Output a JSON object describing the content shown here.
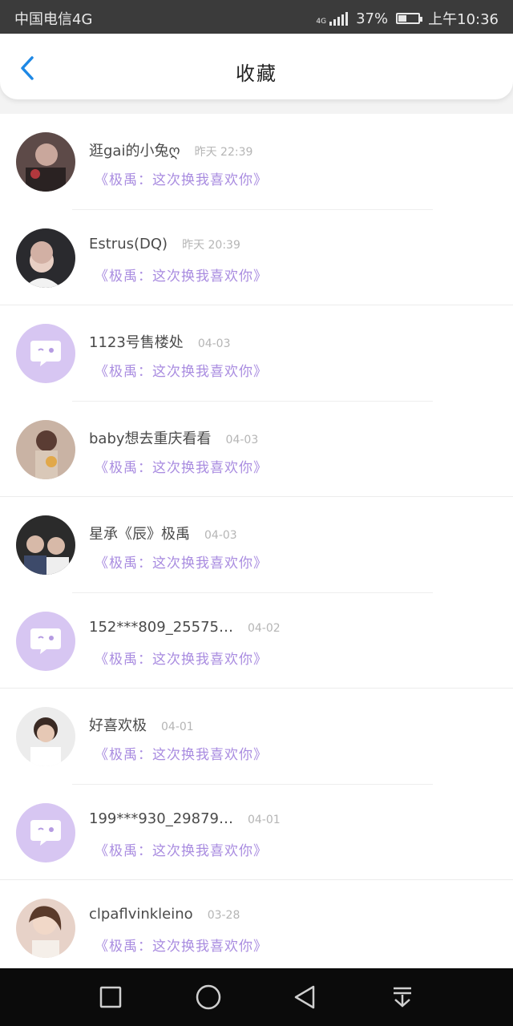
{
  "status_bar": {
    "carrier": "中国电信4G",
    "network": "4G",
    "battery": "37%",
    "battery_level": 0.37,
    "time": "上午10:36"
  },
  "header": {
    "title": "收藏",
    "back_icon": "chevron-left-icon",
    "accent_color": "#1e88e5"
  },
  "colors": {
    "message_color": "#a98ce0",
    "placeholder_avatar": "#d7c6f2"
  },
  "items": [
    {
      "name": "逛gai的小兔ღ",
      "time": "昨天 22:39",
      "message": "《极禹：这次换我喜欢你》",
      "avatar": "photo"
    },
    {
      "name": "Estrus(DQ)",
      "time": "昨天 20:39",
      "message": "《极禹：这次换我喜欢你》",
      "avatar": "photo"
    },
    {
      "name": "1123号售楼处",
      "time": "04-03",
      "message": "《极禹：这次换我喜欢你》",
      "avatar": "placeholder"
    },
    {
      "name": "baby想去重庆看看",
      "time": "04-03",
      "message": "《极禹：这次换我喜欢你》",
      "avatar": "photo"
    },
    {
      "name": "星承《辰》极禹",
      "time": "04-03",
      "message": "《极禹：这次换我喜欢你》",
      "avatar": "photo"
    },
    {
      "name": "152***809_25575…",
      "time": "04-02",
      "message": "《极禹：这次换我喜欢你》",
      "avatar": "placeholder"
    },
    {
      "name": "好喜欢极",
      "time": "04-01",
      "message": "《极禹：这次换我喜欢你》",
      "avatar": "photo"
    },
    {
      "name": "199***930_29879…",
      "time": "04-01",
      "message": "《极禹：这次换我喜欢你》",
      "avatar": "placeholder"
    },
    {
      "name": "clpaflvinkleino",
      "time": "03-28",
      "message": "《极禹：这次换我喜欢你》",
      "avatar": "photo"
    }
  ],
  "nav": {
    "recent_icon": "square-icon",
    "home_icon": "circle-icon",
    "back_icon": "triangle-back-icon",
    "notification_icon": "pull-down-icon"
  }
}
